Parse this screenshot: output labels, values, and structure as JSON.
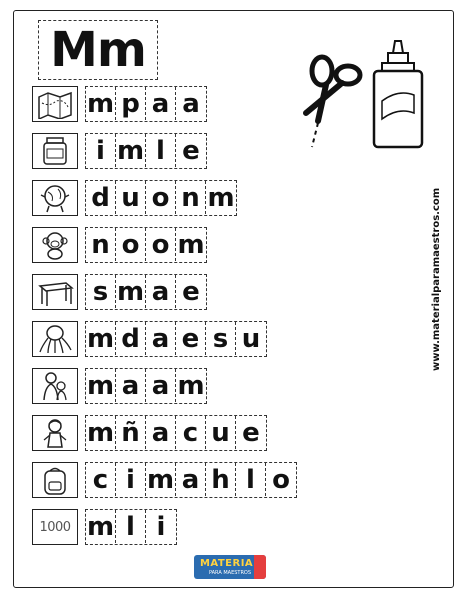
{
  "header": {
    "title": "Mm"
  },
  "website": "www.materialparamaestros.com",
  "logo": {
    "main": "MATERIAL",
    "sub": "PARA MAESTROS"
  },
  "rows": [
    {
      "picture": "map-icon",
      "letters": [
        "m",
        "p",
        "a",
        "a"
      ]
    },
    {
      "picture": "honey-jar-icon",
      "letters": [
        "i",
        "m",
        "l",
        "e"
      ]
    },
    {
      "picture": "world-globe-icon",
      "letters": [
        "d",
        "u",
        "o",
        "n",
        "m"
      ]
    },
    {
      "picture": "monkey-icon",
      "letters": [
        "n",
        "o",
        "o",
        "m"
      ]
    },
    {
      "picture": "table-icon",
      "letters": [
        "s",
        "m",
        "a",
        "e"
      ]
    },
    {
      "picture": "octopus-icon",
      "letters": [
        "m",
        "d",
        "a",
        "e",
        "s",
        "u"
      ]
    },
    {
      "picture": "mother-child-icon",
      "letters": [
        "m",
        "a",
        "a",
        "m"
      ]
    },
    {
      "picture": "doll-icon",
      "letters": [
        "m",
        "ñ",
        "a",
        "c",
        "u",
        "e"
      ]
    },
    {
      "picture": "backpack-icon",
      "letters": [
        "c",
        "i",
        "m",
        "a",
        "h",
        "l",
        "o"
      ]
    },
    {
      "picture": "number-icon",
      "picture_text": "1000",
      "letters": [
        "m",
        "l",
        "i"
      ]
    }
  ]
}
